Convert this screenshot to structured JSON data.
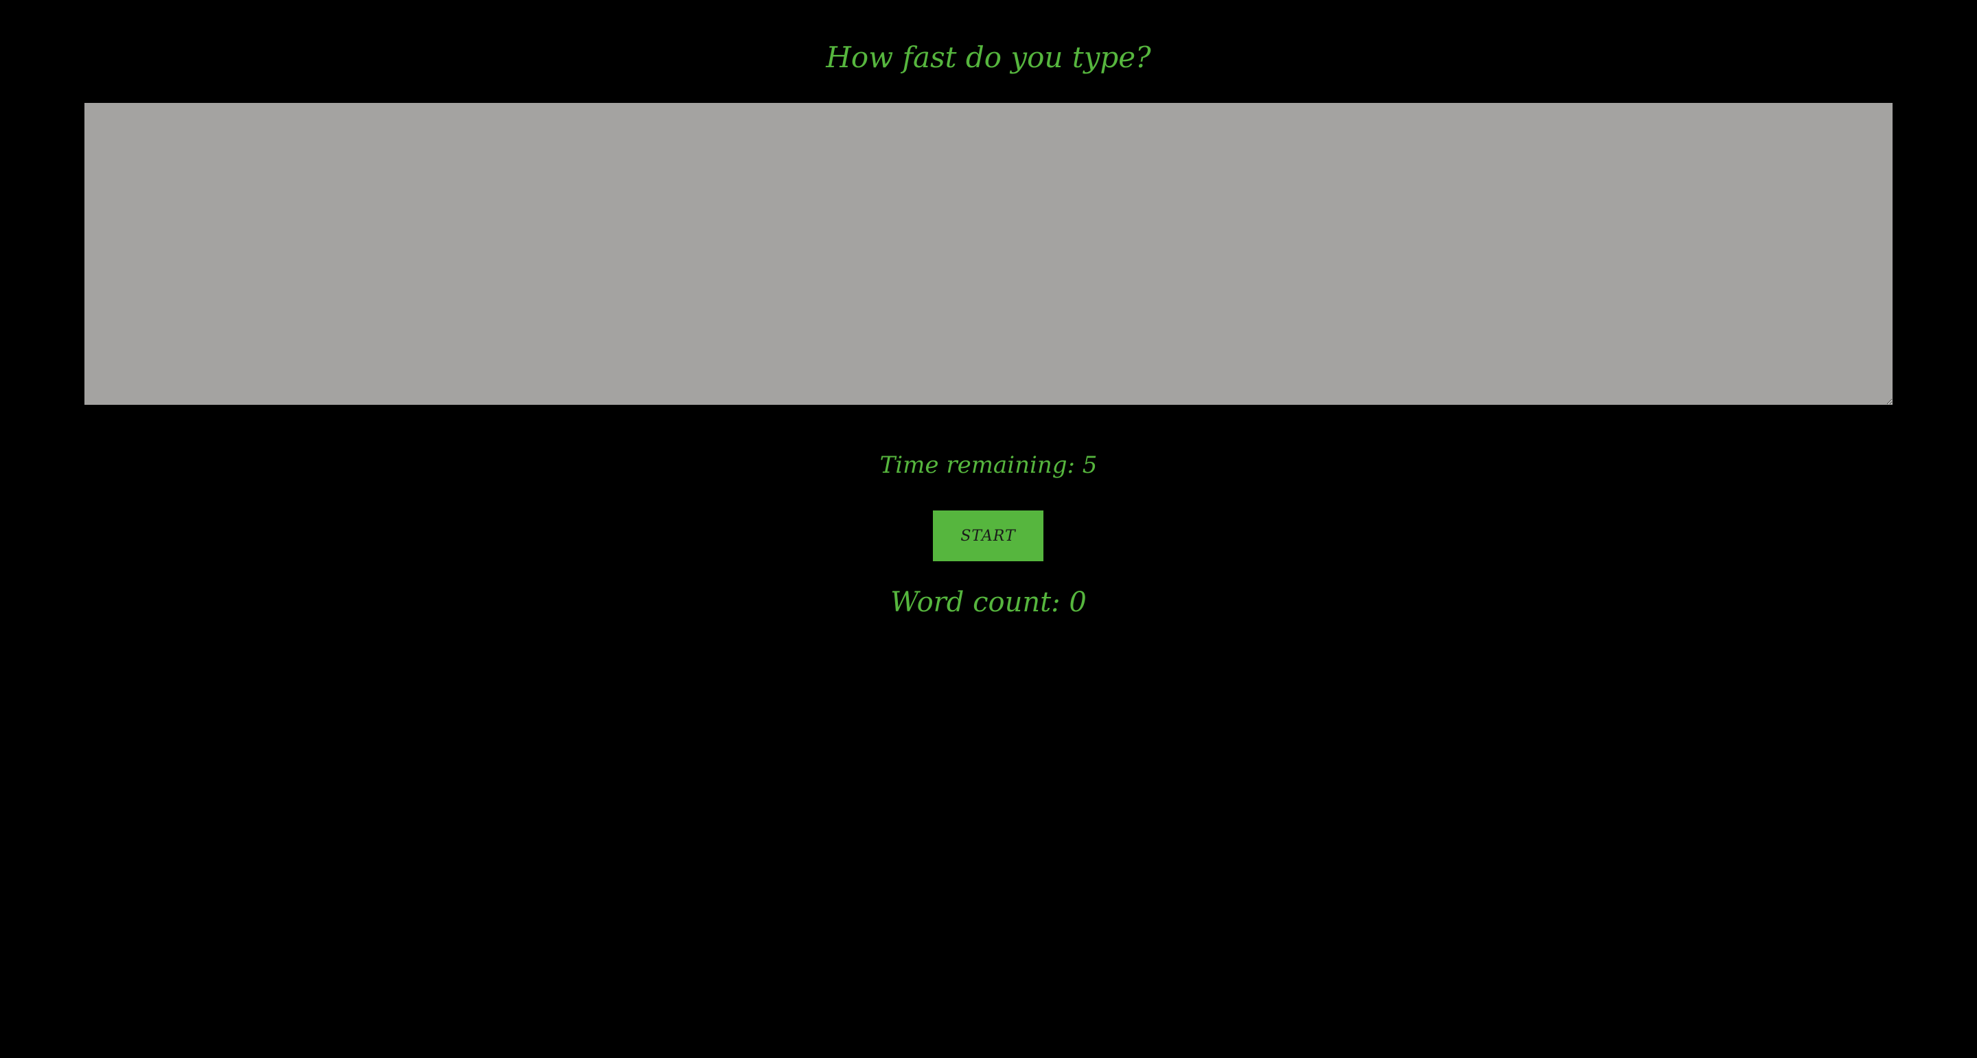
{
  "page": {
    "title": "How fast do you type?"
  },
  "typing_area": {
    "value": "",
    "placeholder": ""
  },
  "timer": {
    "text": "Time remaining: 5"
  },
  "start_button": {
    "label": "START"
  },
  "word_count": {
    "text": "Word count: 0"
  },
  "colors": {
    "background": "#000000",
    "accent_green": "#56b63e",
    "textarea_bg": "#a4a3a1"
  }
}
